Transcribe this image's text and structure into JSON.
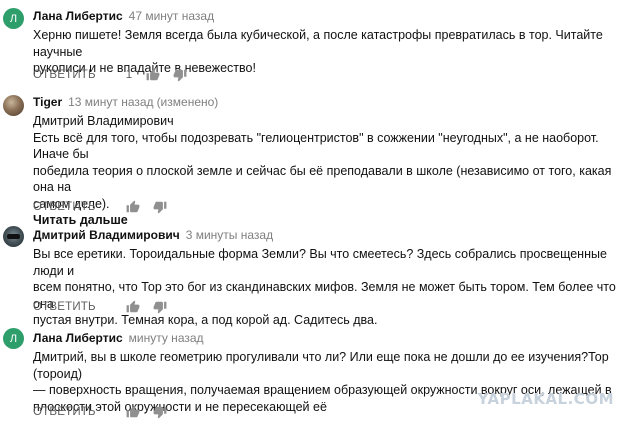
{
  "comments": [
    {
      "author": "Лана Либертис",
      "time": "47 минут назад",
      "avatar_letter": "Л",
      "text": "Херню пишете! Земля всегда была кубической, а после катастрофы превратилась в тор. Читайте научные\nрукописи и не впадайте в невежество!",
      "reply_label": "ОТВЕТИТЬ",
      "likes": "1"
    },
    {
      "author": "Tiger",
      "time": "13 минут назад",
      "edited": "(изменено)",
      "text": "Дмитрий Владимирович\nЕсть всё для того, чтобы подозревать \"гелиоцентристов\" в сожжении \"неугодных\", а не наоборот. Иначе бы\nпобедила теория о плоской земле и сейчас бы её преподавали в школе (независимо от того, какая она на\nсамом деле).",
      "read_more": "Читать дальше",
      "reply_label": "ОТВЕТИТЬ"
    },
    {
      "author": "Дмитрий Владимирович",
      "time": "3 минуты назад",
      "text": "Вы все еретики. Тороидальные форма Земли? Вы что смеетесь? Здесь собрались просвещенные люди и\nвсем понятно, что Тор это бог из скандинавских мифов. Земля не может быть тором. Тем более что она\nпустая внутри. Темная кора, а под корой ад. Садитесь два.",
      "reply_label": "ОТВЕТИТЬ"
    },
    {
      "author": "Лана Либертис",
      "time": "минуту назад",
      "avatar_letter": "Л",
      "text": "Дмитрий, вы в школе геометрию прогуливали что ли? Или еще пока не дошли до ее изучения?Тор (тороид)\n— поверхность вращения, получаемая вращением образующей окружности вокруг оси, лежащей в\nплоскости этой окружности и не пересекающей её",
      "reply_label": "ОТВЕТИТЬ"
    }
  ],
  "icons": {
    "like": "thumb-up-icon",
    "dislike": "thumb-down-icon"
  },
  "colors": {
    "avatar_green": "#2e9e6a",
    "meta_gray": "#7f7f7f",
    "icon_gray": "#909090",
    "watermark": "#c7d2dc"
  },
  "watermark": "YAPLAKAL.COM"
}
